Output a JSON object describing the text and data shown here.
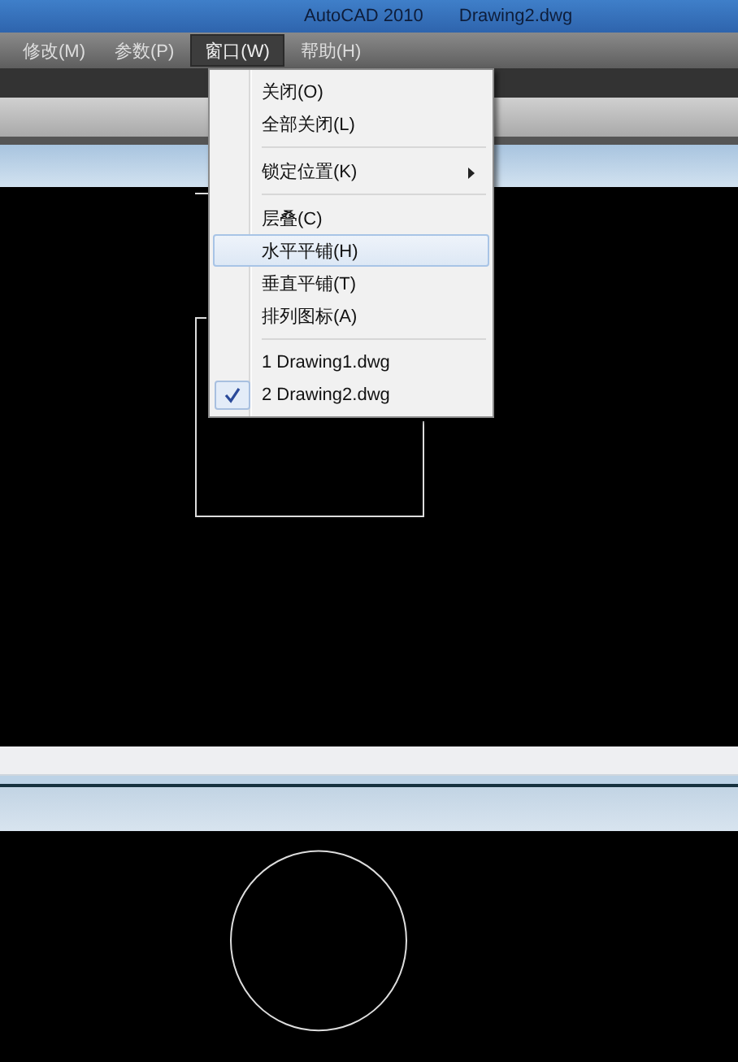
{
  "window": {
    "app": "AutoCAD 2010",
    "document": "Drawing2.dwg"
  },
  "menubar": [
    {
      "label": "修改(M)",
      "selected": false
    },
    {
      "label": "参数(P)",
      "selected": false
    },
    {
      "label": "窗口(W)",
      "selected": true
    },
    {
      "label": "帮助(H)",
      "selected": false
    }
  ],
  "dropdown": [
    {
      "kind": "item",
      "label": "关闭(O)",
      "submenu": false,
      "selected": false,
      "checked": false
    },
    {
      "kind": "item",
      "label": "全部关闭(L)",
      "submenu": false,
      "selected": false,
      "checked": false
    },
    {
      "kind": "separator"
    },
    {
      "kind": "item",
      "label": "锁定位置(K)",
      "submenu": true,
      "selected": false,
      "checked": false
    },
    {
      "kind": "separator"
    },
    {
      "kind": "item",
      "label": "层叠(C)",
      "submenu": false,
      "selected": false,
      "checked": false
    },
    {
      "kind": "item",
      "label": "水平平铺(H)",
      "submenu": false,
      "selected": true,
      "checked": false
    },
    {
      "kind": "item",
      "label": "垂直平铺(T)",
      "submenu": false,
      "selected": false,
      "checked": false
    },
    {
      "kind": "item",
      "label": "排列图标(A)",
      "submenu": false,
      "selected": false,
      "checked": false
    },
    {
      "kind": "separator"
    },
    {
      "kind": "item",
      "label": "1 Drawing1.dwg",
      "submenu": false,
      "selected": false,
      "checked": false
    },
    {
      "kind": "item",
      "label": "2 Drawing2.dwg",
      "submenu": false,
      "selected": false,
      "checked": true
    }
  ]
}
